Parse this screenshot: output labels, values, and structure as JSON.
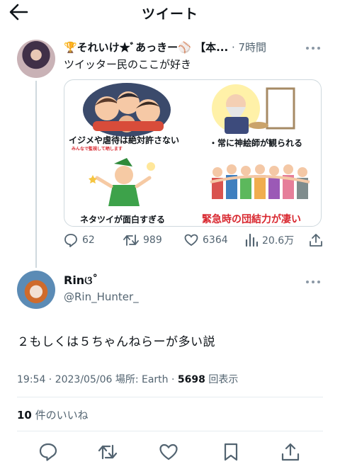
{
  "header": {
    "title": "ツイート",
    "back_icon": "arrow-left-icon"
  },
  "quoted_tweet": {
    "name": "🏆それいけ★ﾞあっきー⚾️ 【本...",
    "separator": "·",
    "time": "7時間",
    "text": "ツイッター民のここが好き",
    "media": {
      "captions": [
        "イジメや虐待は絶対許さない",
        "みんなで監視して晒します",
        "・常に神絵師が観られる",
        "ネタツイが面白すぎる",
        "緊急時の団結力が凄い"
      ]
    },
    "stats": {
      "replies": "62",
      "retweets": "989",
      "likes": "6364",
      "views": "20.6万"
    }
  },
  "tweet": {
    "name": "Rinଓ˚",
    "handle": "@Rin_Hunter_",
    "text": "２もしくは５ちゃんねらーが多い説",
    "time": "19:54 · 2023/05/06 場所: Earth · ",
    "view_count": "5698",
    "view_label": " 回表示",
    "like_count": "10",
    "like_label": " 件のいいね"
  },
  "colors": {
    "text": "#0f1419",
    "secondary": "#536471",
    "border": "#cfd9de",
    "caption_red": "#d8262e"
  }
}
